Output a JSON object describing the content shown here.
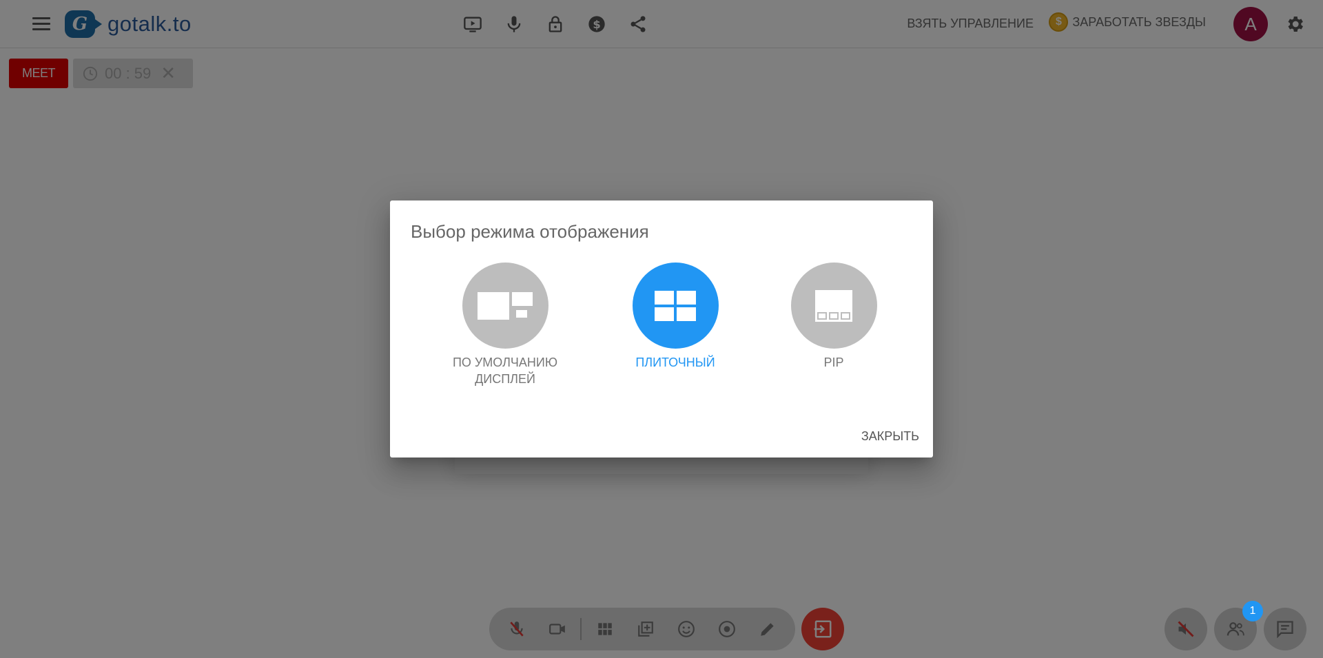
{
  "app": {
    "logo_letter": "G",
    "logo_text": "gotalk.to"
  },
  "header": {
    "take_control": "ВЗЯТЬ УПРАВЛЕНИЕ",
    "earn_stars": "ЗАРАБОТАТЬ ЗВЕЗДЫ",
    "coin_symbol": "$",
    "avatar_letter": "A",
    "icons": [
      "screen-share-icon",
      "microphone-icon",
      "lock-icon",
      "dollar-icon",
      "share-icon"
    ]
  },
  "room": {
    "meet_label": "MEET",
    "timer": "00 : 59",
    "timer_close": "✕"
  },
  "dialog": {
    "title": "Выбор режима отображения",
    "options": [
      {
        "label": "ПО УМОЛЧАНИЮ ДИСПЛЕЙ",
        "active": false
      },
      {
        "label": "ПЛИТОЧНЫЙ",
        "active": true
      },
      {
        "label": "PIP",
        "active": false
      }
    ],
    "close_label": "ЗАКРЫТЬ"
  },
  "footer": {
    "participants_count": "1"
  },
  "colors": {
    "accent": "#2196f3",
    "meet": "#e00000",
    "exit": "#f44336",
    "avatar": "#a01045"
  }
}
